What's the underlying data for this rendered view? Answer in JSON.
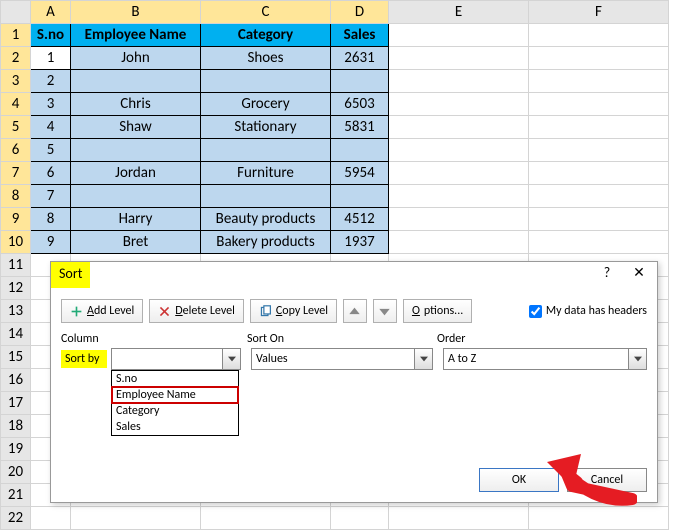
{
  "columns": [
    "A",
    "B",
    "C",
    "D",
    "E",
    "F"
  ],
  "rows": [
    "1",
    "2",
    "3",
    "4",
    "5",
    "6",
    "7",
    "8",
    "9",
    "10",
    "11",
    "12",
    "13",
    "14",
    "15",
    "16",
    "17",
    "18",
    "19",
    "20",
    "21",
    "22"
  ],
  "headers": {
    "A": "S.no",
    "B": "Employee Name",
    "C": "Category",
    "D": "Sales"
  },
  "table": [
    {
      "sno": "1",
      "name": "John",
      "cat": "Shoes",
      "sales": "2631"
    },
    {
      "sno": "2",
      "name": "",
      "cat": "",
      "sales": ""
    },
    {
      "sno": "3",
      "name": "Chris",
      "cat": "Grocery",
      "sales": "6503"
    },
    {
      "sno": "4",
      "name": "Shaw",
      "cat": "Stationary",
      "sales": "5831"
    },
    {
      "sno": "5",
      "name": "",
      "cat": "",
      "sales": ""
    },
    {
      "sno": "6",
      "name": "Jordan",
      "cat": "Furniture",
      "sales": "5954"
    },
    {
      "sno": "7",
      "name": "",
      "cat": "",
      "sales": ""
    },
    {
      "sno": "8",
      "name": "Harry",
      "cat": "Beauty products",
      "sales": "4512"
    },
    {
      "sno": "9",
      "name": "Bret",
      "cat": "Bakery products",
      "sales": "1937"
    }
  ],
  "dialog": {
    "title": "Sort",
    "help": "?",
    "close": "✕",
    "buttons": {
      "add": "Add Level",
      "delete": "Delete Level",
      "copy": "Copy Level",
      "options": "Options..."
    },
    "checkbox": "My data has headers",
    "labels": {
      "column": "Column",
      "sorton": "Sort On",
      "order": "Order"
    },
    "sortby": "Sort by",
    "combo": {
      "column": "",
      "sorton": "Values",
      "order": "A to Z"
    },
    "dropdown": [
      "S.no",
      "Employee Name",
      "Category",
      "Sales"
    ],
    "ok": "OK",
    "cancel": "Cancel"
  }
}
